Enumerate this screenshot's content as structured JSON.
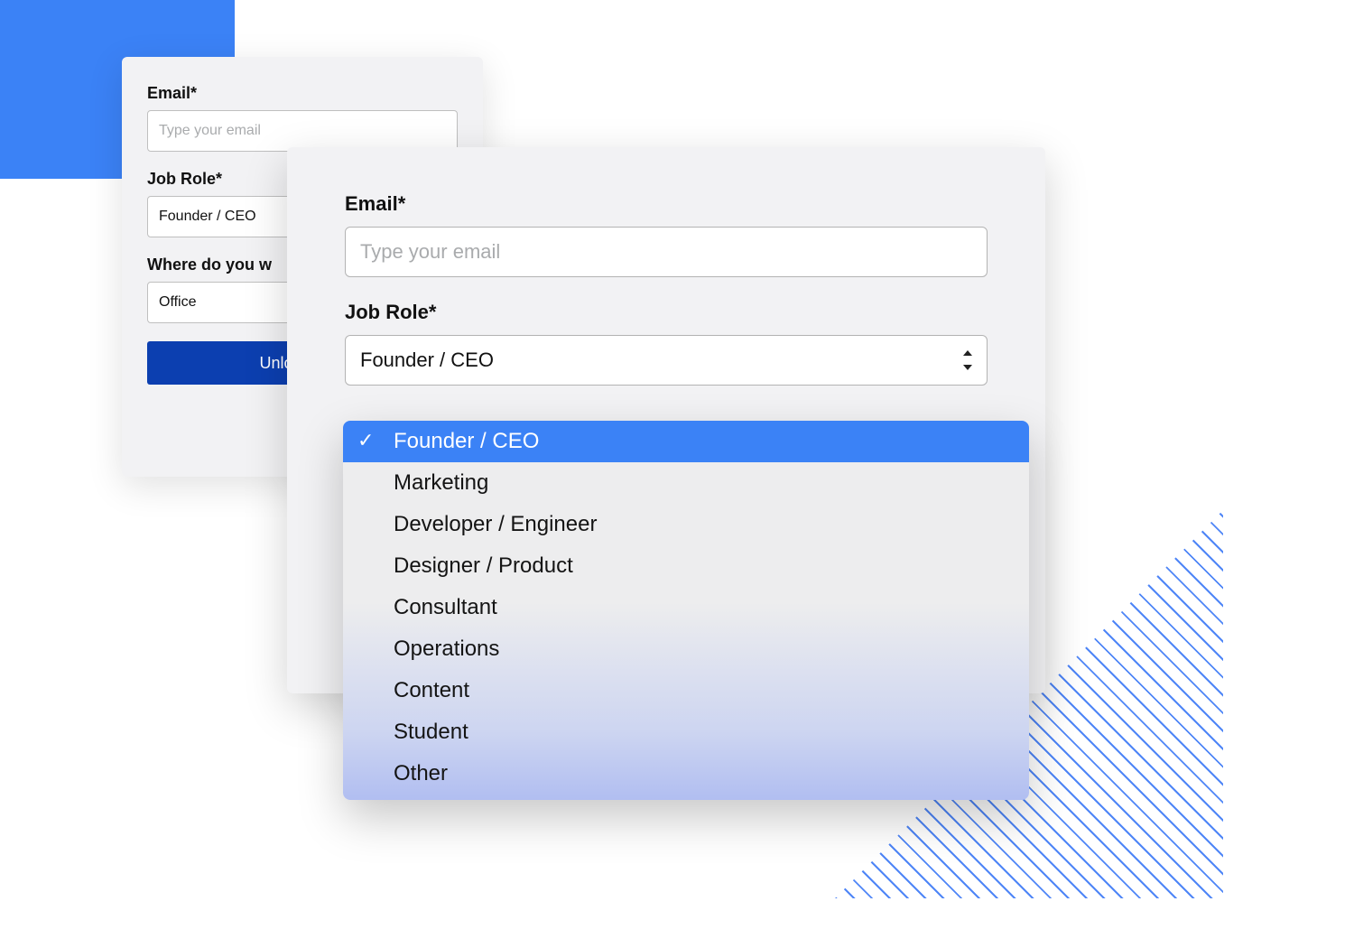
{
  "decor": {
    "square_color": "#3b82f6",
    "hatch_color": "#4f86f7"
  },
  "back_card": {
    "email_label": "Email*",
    "email_placeholder": "Type your email",
    "job_label": "Job Role*",
    "job_value": "Founder / CEO",
    "work_label": "Where do you w",
    "work_value": "Office",
    "button_label": "Unlock your"
  },
  "front_card": {
    "email_label": "Email*",
    "email_placeholder": "Type your email",
    "job_label": "Job Role*",
    "job_value": "Founder / CEO"
  },
  "dropdown": {
    "selected_index": 0,
    "options": [
      "Founder / CEO",
      "Marketing",
      "Developer / Engineer",
      "Designer / Product",
      "Consultant",
      "Operations",
      "Content",
      "Student",
      "Other"
    ]
  }
}
